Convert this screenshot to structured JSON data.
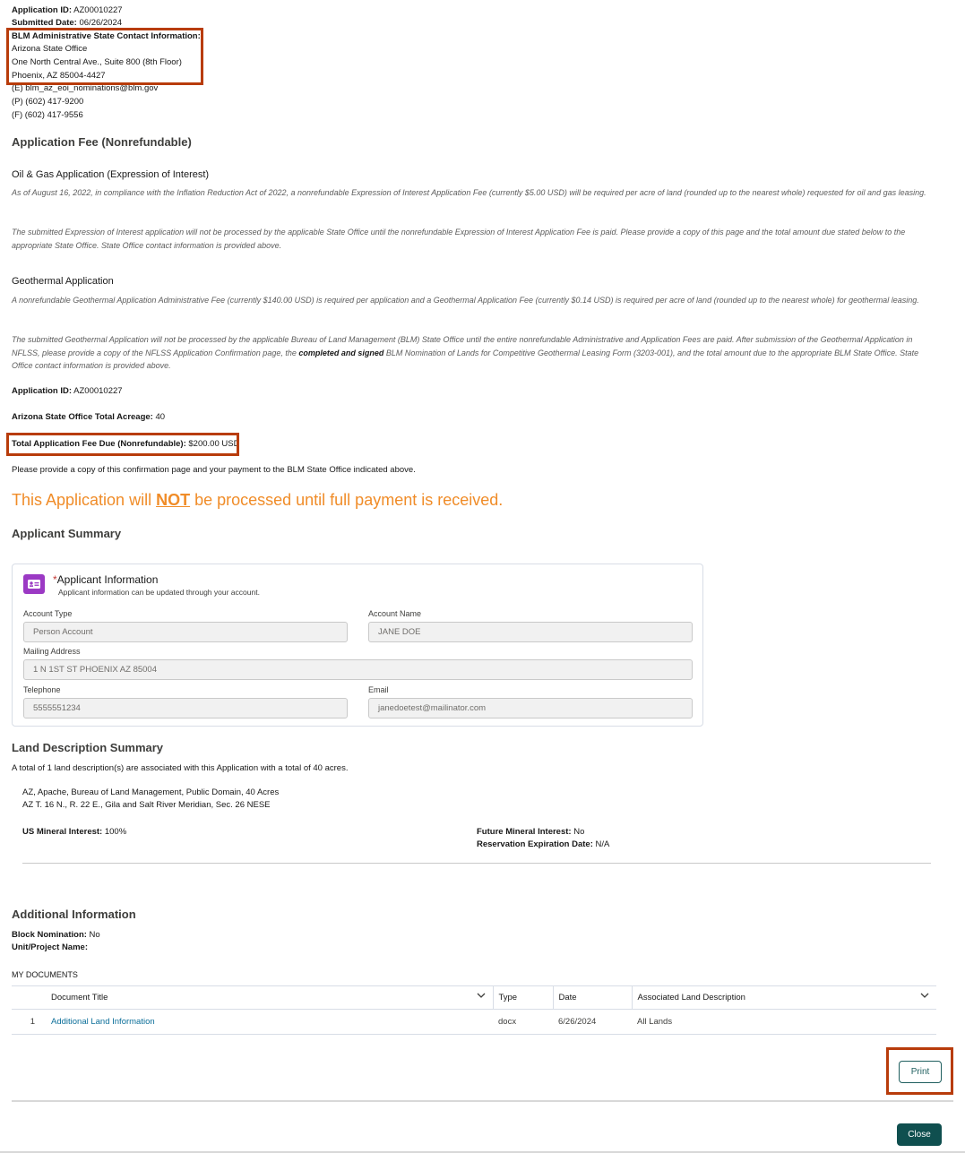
{
  "header": {
    "app_id_label": "Application ID:",
    "app_id_value": " AZ00010227",
    "submitted_label": "Submitted Date:",
    "submitted_value": " 06/26/2024",
    "contact_label": "BLM Administrative State Contact Information:",
    "contact_lines": [
      "Arizona State Office",
      "One North Central Ave., Suite 800 (8th Floor)",
      "Phoenix, AZ 85004-4427",
      "(E) blm_az_eoi_nominations@blm.gov",
      "(P) (602) 417-9200",
      "(F) (602) 417-9556"
    ]
  },
  "fee": {
    "heading": "Application Fee (Nonrefundable)",
    "oil_gas_heading": "Oil & Gas Application (Expression of Interest)",
    "oil_gas_p1": "As of August 16, 2022, in compliance with the Inflation Reduction Act of 2022, a nonrefundable Expression of Interest Application Fee (currently $5.00 USD) will be required per acre of land (rounded up to the nearest whole) requested for oil and gas leasing.",
    "oil_gas_p2": "The submitted Expression of Interest application will not be processed by the applicable State Office until the nonrefundable Expression of Interest Application Fee is paid. Please provide a copy of this page and the total amount due stated below to the appropriate State Office. State Office contact information is provided above.",
    "geo_heading": "Geothermal Application",
    "geo_p1": "A nonrefundable Geothermal Application Administrative Fee (currently $140.00 USD) is required per application and a Geothermal Application Fee (currently $0.14 USD) is required per acre of land (rounded up to the nearest whole) for geothermal leasing.",
    "geo_p2_a": "The submitted Geothermal Application will not be processed by the applicable Bureau of Land Management (BLM) State Office until the entire nonrefundable Administrative and Application Fees are paid. After submission of the Geothermal Application in NFLSS, please provide a copy of the NFLSS Application Confirmation page, the ",
    "geo_p2_bold": "completed and signed",
    "geo_p2_b": " BLM Nomination of Lands for Competitive Geothermal Leasing Form (3203-001), and the total amount due to the appropriate BLM State Office. State Office contact information is provided above.",
    "app_id_label": "Application ID:",
    "app_id_value": " AZ00010227",
    "acreage_label": "Arizona State Office Total Acreage:",
    "acreage_value": " 40",
    "total_label": "Total Application Fee Due (Nonrefundable):",
    "total_value": " $200.00 USD",
    "note": "Please provide a copy of this confirmation page and your payment to the BLM State Office indicated above.",
    "warning_pre": "This Application will ",
    "warning_not": "NOT",
    "warning_post": " be processed until full payment is received."
  },
  "applicant": {
    "heading": "Applicant Summary",
    "card_required": "*",
    "card_title": "Applicant Information",
    "card_subtitle": "Applicant information can be updated through your account.",
    "account_type_label": "Account Type",
    "account_type_value": "Person Account",
    "account_name_label": "Account Name",
    "account_name_value": "JANE DOE",
    "mailing_label": "Mailing Address",
    "mailing_value": "1 N 1ST ST PHOENIX AZ 85004",
    "telephone_label": "Telephone",
    "telephone_value": "5555551234",
    "email_label": "Email",
    "email_value": "janedoetest@mailinator.com"
  },
  "land": {
    "heading": "Land Description Summary",
    "summary": "A total of 1 land description(s) are associated with this Application with a total of 40 acres.",
    "desc_line1": "AZ, Apache, Bureau of Land Management, Public Domain, 40 Acres",
    "desc_line2": "AZ T. 16 N., R. 22 E., Gila and Salt River Meridian, Sec. 26 NESE",
    "us_mineral_label": "US Mineral Interest:",
    "us_mineral_value": " 100%",
    "future_label": "Future Mineral Interest:",
    "future_value": " No",
    "reservation_label": "Reservation Expiration Date:",
    "reservation_value": " N/A"
  },
  "additional": {
    "heading": "Additional Information",
    "block_label": "Block Nomination:",
    "block_value": " No",
    "unit_label": "Unit/Project Name:",
    "unit_value": "",
    "docs_label": "MY DOCUMENTS",
    "columns": [
      "Document Title",
      "Type",
      "Date",
      "Associated Land Description"
    ],
    "rows": [
      {
        "num": "1",
        "title": "Additional Land Information",
        "type": "docx",
        "date": "6/26/2024",
        "land": "All Lands"
      }
    ]
  },
  "actions": {
    "print": "Print",
    "close": "Close"
  },
  "colors": {
    "highlight": "#b83c0b",
    "warning": "#f08c28",
    "primary": "#0f4f4f",
    "card_icon": "#9b39c4"
  }
}
